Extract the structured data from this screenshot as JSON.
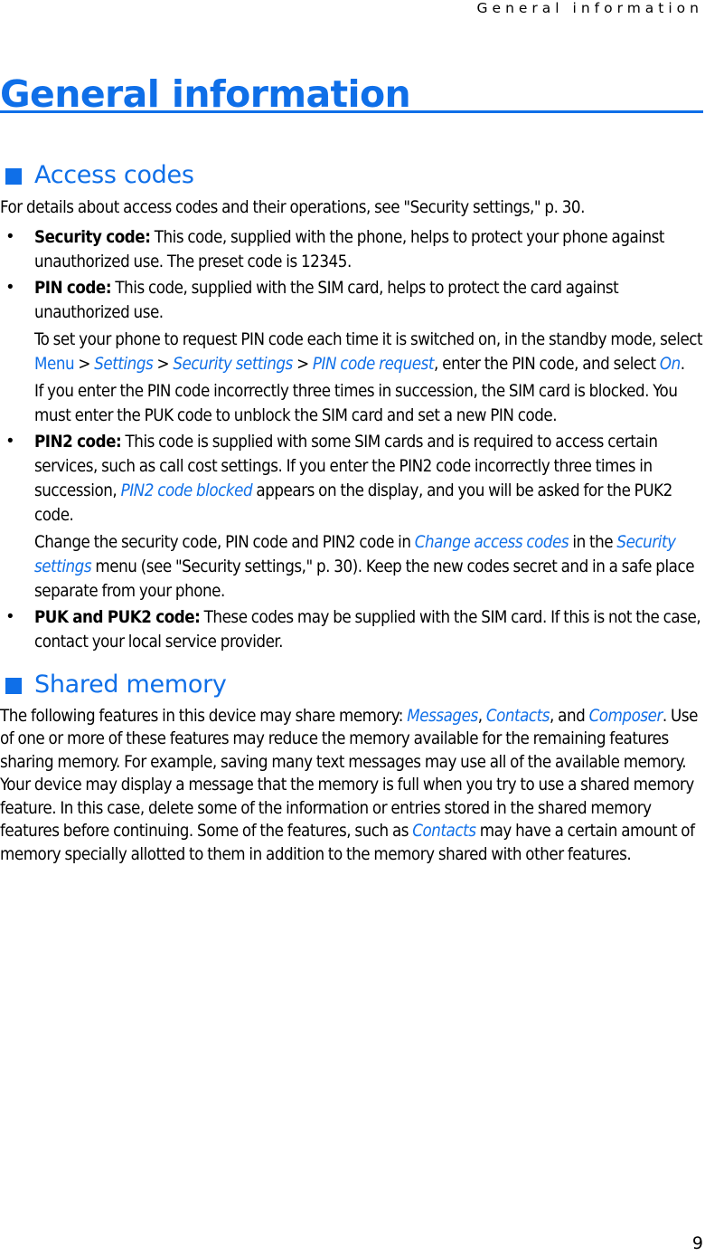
{
  "document": {
    "running_header": "General information",
    "chapter_title": "General information",
    "page_number": "9",
    "accent_color": "#0F6FE8",
    "text_color": "#000000",
    "background_color": "#ffffff"
  },
  "sections": [
    {
      "id": "access-codes",
      "heading": "Access codes",
      "bullet_glyph": "square",
      "intro": "For details about access codes and their operations, see \"Security settings,\" p. 30.",
      "items": [
        {
          "label": "Security code:",
          "paragraphs": [
            {
              "runs": [
                {
                  "text": " This code, supplied with the phone, helps to protect your phone against unauthorized use. The preset code is 12345.",
                  "style": "plain"
                }
              ]
            }
          ]
        },
        {
          "label": "PIN code:",
          "paragraphs": [
            {
              "runs": [
                {
                  "text": " This code, supplied with the SIM card, helps to protect the card against unauthorized use.",
                  "style": "plain"
                }
              ]
            },
            {
              "runs": [
                {
                  "text": "To set your phone to request PIN code each time it is switched on, in the standby mode, select ",
                  "style": "plain"
                },
                {
                  "text": "Menu",
                  "style": "ui-upright"
                },
                {
                  "text": " > ",
                  "style": "plain"
                },
                {
                  "text": "Settings",
                  "style": "ui-italic"
                },
                {
                  "text": " > ",
                  "style": "plain"
                },
                {
                  "text": "Security settings",
                  "style": "ui-italic"
                },
                {
                  "text": " > ",
                  "style": "plain"
                },
                {
                  "text": "PIN code request",
                  "style": "ui-italic"
                },
                {
                  "text": ", enter the PIN code, and select ",
                  "style": "plain"
                },
                {
                  "text": "On",
                  "style": "ui-italic"
                },
                {
                  "text": ".",
                  "style": "plain"
                }
              ]
            },
            {
              "runs": [
                {
                  "text": "If you enter the PIN code incorrectly three times in succession, the SIM card is blocked. You must enter the PUK code to unblock the SIM card and set a new PIN code.",
                  "style": "plain"
                }
              ]
            }
          ]
        },
        {
          "label": "PIN2 code:",
          "paragraphs": [
            {
              "runs": [
                {
                  "text": " This code is supplied with some SIM cards and is required to access certain services, such as call cost settings. If you enter the PIN2 code incorrectly three times in succession, ",
                  "style": "plain"
                },
                {
                  "text": "PIN2 code blocked",
                  "style": "ui-italic"
                },
                {
                  "text": " appears on the display, and you will be asked for the PUK2 code.",
                  "style": "plain"
                }
              ]
            },
            {
              "runs": [
                {
                  "text": "Change the security code, PIN code and PIN2 code in ",
                  "style": "plain"
                },
                {
                  "text": "Change access codes",
                  "style": "ui-italic"
                },
                {
                  "text": " in the ",
                  "style": "plain"
                },
                {
                  "text": "Security settings",
                  "style": "ui-italic"
                },
                {
                  "text": " menu (see \"Security settings,\" p. 30). Keep the new codes secret and in a safe place separate from your phone.",
                  "style": "plain"
                }
              ]
            }
          ]
        },
        {
          "label": "PUK and PUK2 code:",
          "paragraphs": [
            {
              "runs": [
                {
                  "text": " These codes may be supplied with the SIM card. If this is not the case, contact your local service provider.",
                  "style": "plain"
                }
              ]
            }
          ]
        }
      ]
    },
    {
      "id": "shared-memory",
      "heading": "Shared memory",
      "bullet_glyph": "square",
      "paragraphs": [
        {
          "runs": [
            {
              "text": "The following features in this device may share memory: ",
              "style": "plain"
            },
            {
              "text": "Messages",
              "style": "ui-italic"
            },
            {
              "text": ", ",
              "style": "plain"
            },
            {
              "text": "Contacts",
              "style": "ui-italic"
            },
            {
              "text": ", and ",
              "style": "plain"
            },
            {
              "text": "Composer",
              "style": "ui-italic"
            },
            {
              "text": ". Use of one or more of these features may reduce the memory available for the remaining features sharing memory. For example, saving many text messages may use all of the available memory. Your device may display a message that the memory is full when you try to use a shared memory feature. In this case, delete some of the information or entries stored in the shared memory features before continuing. Some of the features, such as ",
              "style": "plain"
            },
            {
              "text": "Contacts",
              "style": "ui-italic"
            },
            {
              "text": " may have a certain amount of memory specially allotted to them in addition to the memory shared with other features.",
              "style": "plain"
            }
          ]
        }
      ]
    }
  ]
}
